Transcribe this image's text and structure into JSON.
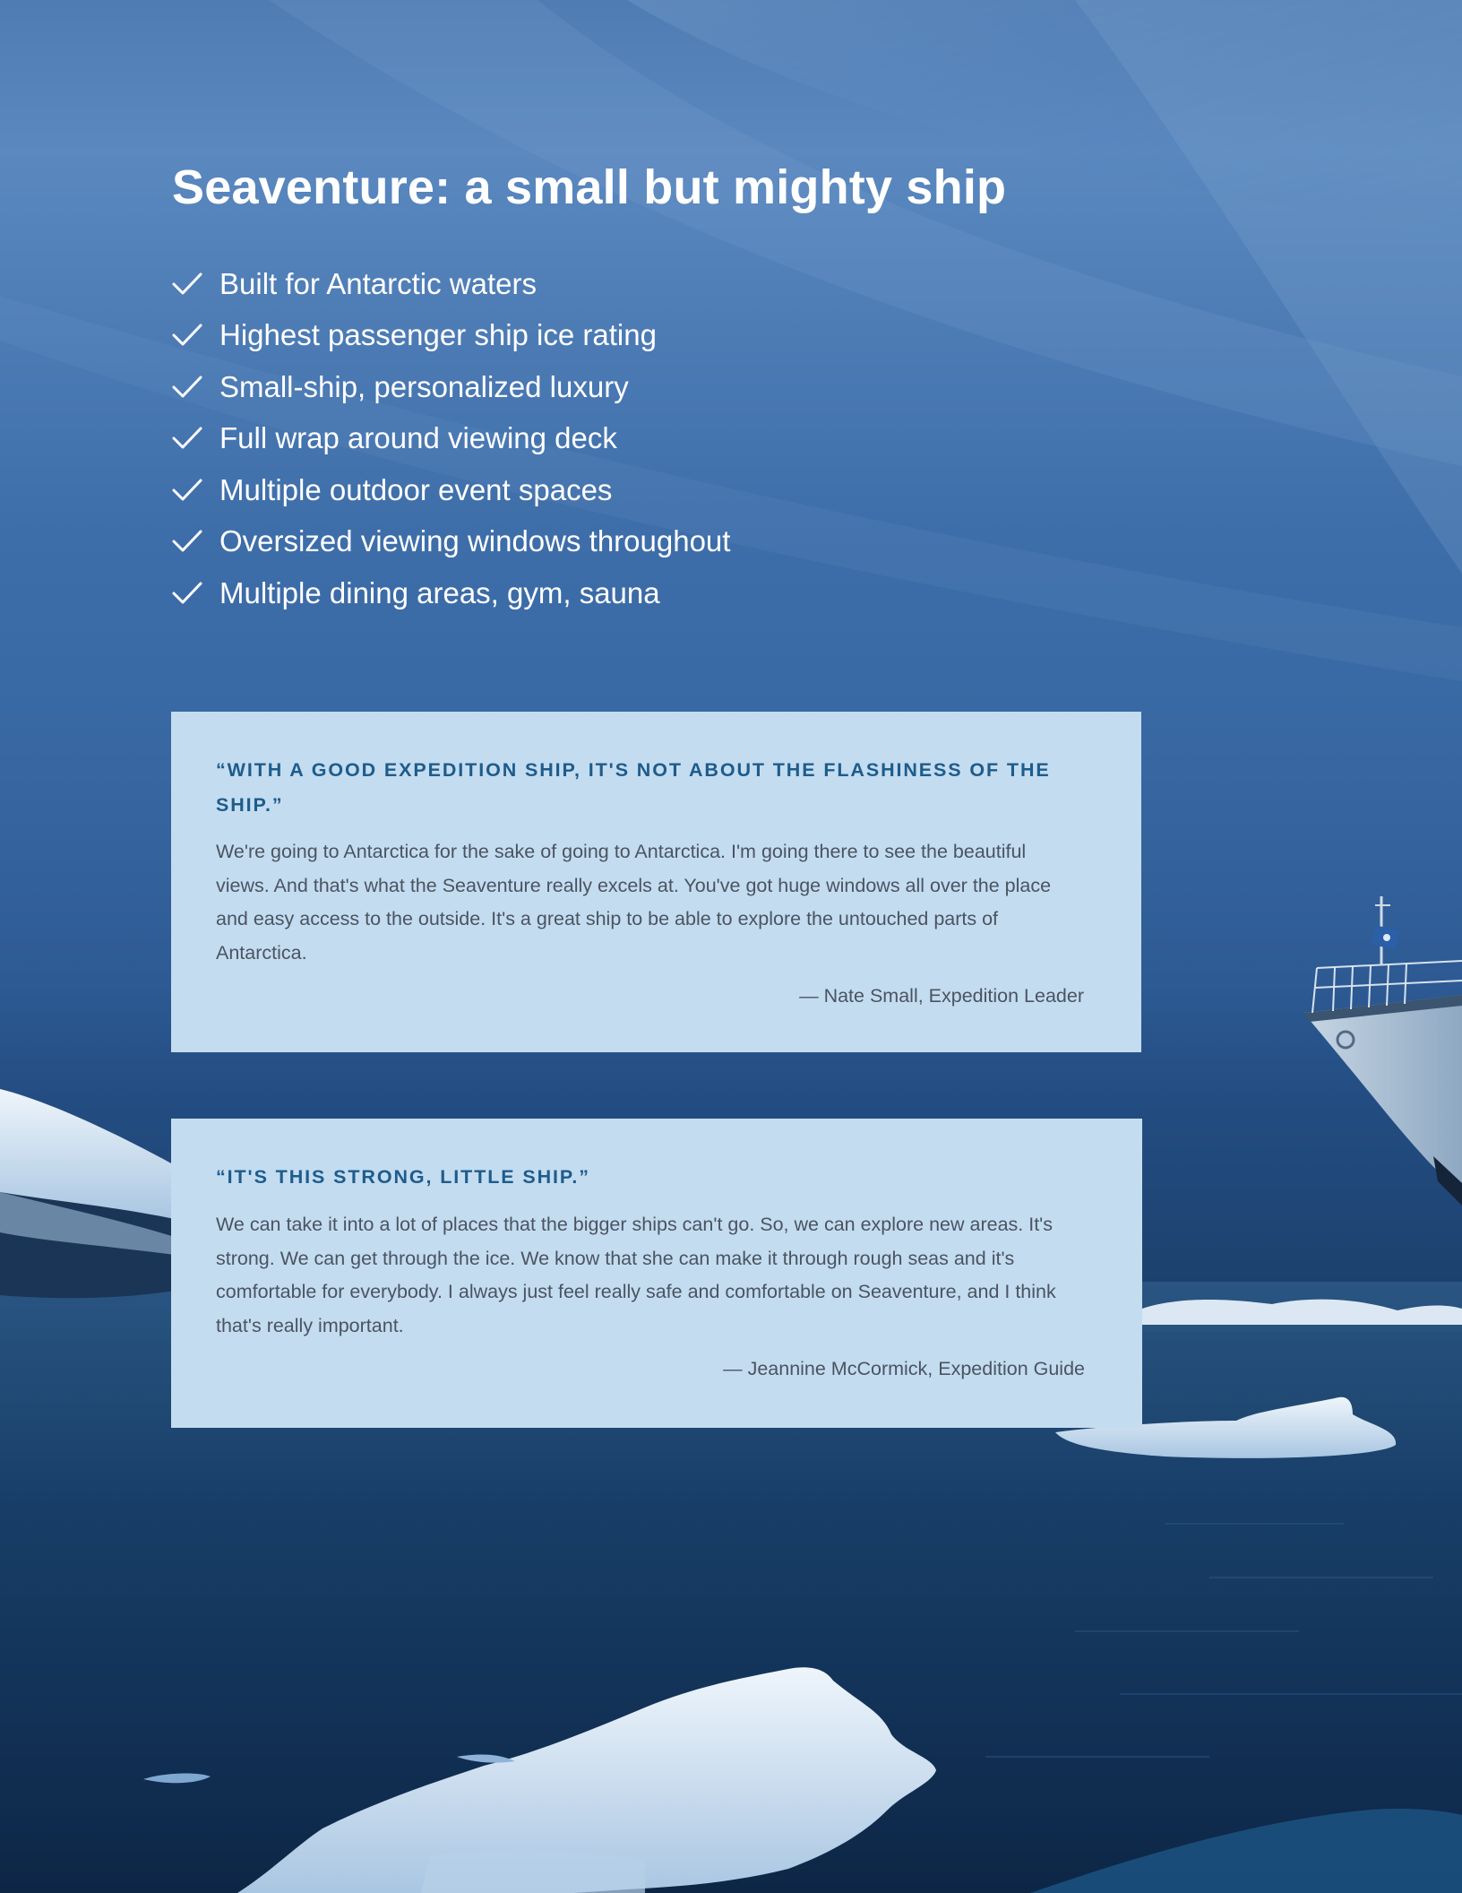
{
  "page": {
    "title": "Seaventure: a small but mighty ship"
  },
  "features": [
    {
      "icon": "check-icon",
      "label": "Built for Antarctic waters"
    },
    {
      "icon": "check-icon",
      "label": "Highest passenger ship ice rating"
    },
    {
      "icon": "check-icon",
      "label": "Small-ship, personalized luxury"
    },
    {
      "icon": "check-icon",
      "label": "Full wrap around viewing deck"
    },
    {
      "icon": "check-icon",
      "label": "Multiple outdoor event spaces"
    },
    {
      "icon": "check-icon",
      "label": "Oversized viewing windows throughout"
    },
    {
      "icon": "check-icon",
      "label": "Multiple dining areas, gym, sauna"
    }
  ],
  "quotes": [
    {
      "heading": "“WITH A GOOD EXPEDITION SHIP, IT'S NOT ABOUT THE FLASHINESS OF THE SHIP.”",
      "body": "We're going to Antarctica for the sake of going to Antarctica. I'm going there to see the beautiful views. And that's what the Seaventure really excels at. You've got huge windows all over the place and easy access to the outside. It's a great ship to be able to explore the untouched parts of Antarctica.",
      "attribution": "— Nate Small, Expedition Leader"
    },
    {
      "heading": "“IT'S THIS STRONG, LITTLE SHIP.”",
      "body": "We can take it into a lot of places that the bigger ships can't go. So, we can explore new areas. It's strong. We can get through the ice. We know that she can make it through rough seas and it's comfortable for everybody. I always just feel really safe and comfortable on Seaventure, and I think that's really important.",
      "attribution": "— Jeannine McCormick, Expedition Guide"
    }
  ],
  "colors": {
    "sky_top": "#5a88bf",
    "sea_dark": "#0f2b4e",
    "card_background": "#c4dcf0",
    "quote_heading": "#1d5c8c",
    "quote_text": "#4a5462",
    "title_text": "#ffffff"
  }
}
